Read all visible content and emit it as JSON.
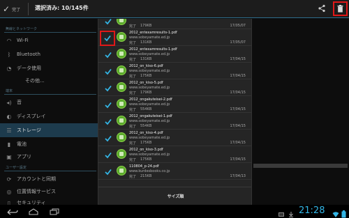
{
  "action_bar": {
    "done_label": "完了",
    "selected_count": "選択済み: 10/145件",
    "share_icon": "share-icon",
    "delete_icon": "trash-icon"
  },
  "settings": {
    "header_wireless": "無線とネットワーク",
    "header_device": "端末",
    "header_user": "ユーザー設定",
    "items": [
      {
        "label": "Wi-Fi",
        "icon": "wifi-icon"
      },
      {
        "label": "Bluetooth",
        "icon": "bluetooth-icon"
      },
      {
        "label": "データ使用",
        "icon": "data-usage-icon"
      },
      {
        "label": "その他...",
        "icon": ""
      },
      {
        "label": "音",
        "icon": "sound-icon"
      },
      {
        "label": "ディスプレイ",
        "icon": "display-icon"
      },
      {
        "label": "ストレージ",
        "icon": "storage-icon"
      },
      {
        "label": "電池",
        "icon": "battery-icon"
      },
      {
        "label": "アプリ",
        "icon": "apps-icon"
      },
      {
        "label": "アカウントと同期",
        "icon": "sync-icon"
      },
      {
        "label": "位置情報サービス",
        "icon": "location-icon"
      },
      {
        "label": "セキュリティ",
        "icon": "lock-icon"
      }
    ]
  },
  "downloads": {
    "rows": [
      {
        "name": "",
        "host": "",
        "status": "完了",
        "size": "179KB",
        "date": "17/05/07",
        "checked": true
      },
      {
        "name": "2012_entexamresults-1.pdf",
        "host": "www.sobeyamate.ed.jp",
        "status": "完了",
        "size": "131KB",
        "date": "17/05/07",
        "checked": true
      },
      {
        "name": "2012_entexamresults-1.pdf",
        "host": "www.sobeyamate.ed.jp",
        "status": "完了",
        "size": "131KB",
        "date": "17/04/15",
        "checked": true
      },
      {
        "name": "2012_on_kiso-6.pdf",
        "host": "www.sobeyamate.ed.jp",
        "status": "完了",
        "size": "175KB",
        "date": "17/04/15",
        "checked": true
      },
      {
        "name": "2012_on_kiso-5.pdf",
        "host": "www.sobeyamate.ed.jp",
        "status": "完了",
        "size": "179KB",
        "date": "17/04/15",
        "checked": true
      },
      {
        "name": "2012_ongakuteisei-2.pdf",
        "host": "www.sobeyamate.ed.jp",
        "status": "完了",
        "size": "554KB",
        "date": "17/04/15",
        "checked": true
      },
      {
        "name": "2012_ongakuteisei-1.pdf",
        "host": "www.sobeyamate.ed.jp",
        "status": "完了",
        "size": "554KB",
        "date": "17/04/15",
        "checked": true
      },
      {
        "name": "2012_on_kiso-4.pdf",
        "host": "www.sobeyamate.ed.jp",
        "status": "完了",
        "size": "175KB",
        "date": "17/04/15",
        "checked": true
      },
      {
        "name": "2012_on_kiso-3.pdf",
        "host": "www.sobeyamate.ed.jp",
        "status": "完了",
        "size": "175KB",
        "date": "17/04/15",
        "checked": true
      },
      {
        "name": "110804_p-24.pdf",
        "host": "www.kurdesbooks.co.jp",
        "status": "完了",
        "size": "215KB",
        "date": "17/04/13",
        "checked": true
      }
    ],
    "sort_label": "サイズ順"
  },
  "system_bar": {
    "clock": "21:28",
    "nav": [
      "back-icon",
      "home-icon",
      "recent-apps-icon"
    ]
  },
  "colors": {
    "accent": "#33b5e5",
    "highlight_box": "#e01818",
    "checkbox": "#33b5e5",
    "download_icon": "#5aaa2a"
  }
}
